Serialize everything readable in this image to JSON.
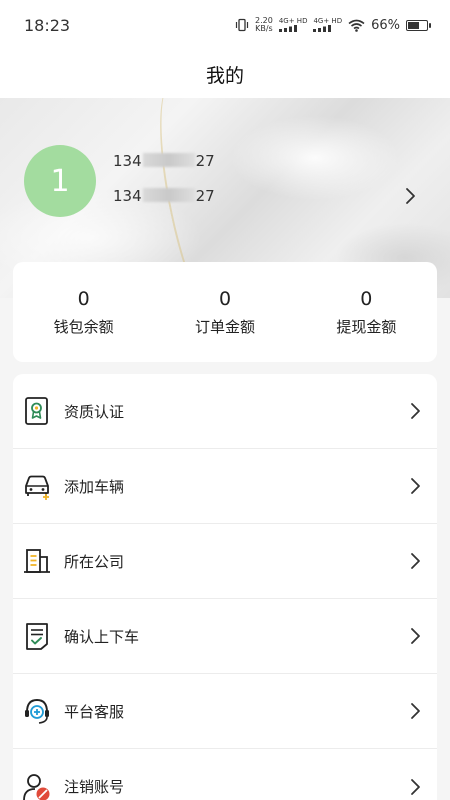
{
  "status_bar": {
    "time": "18:23",
    "net_speed": "2.20",
    "net_speed_unit": "KB/s",
    "network_1": "4G+ HD",
    "network_2": "4G+ HD",
    "battery_percent": "66%",
    "battery_level": 0.66,
    "icons": [
      "vibrate-icon",
      "signal-icon",
      "signal-icon",
      "wifi-icon",
      "battery-icon"
    ]
  },
  "header": {
    "title": "我的"
  },
  "profile": {
    "avatar_text": "1",
    "avatar_color": "#a3dc9f",
    "phone_prefix_1": "134",
    "phone_suffix_1": "27",
    "phone_prefix_2": "134",
    "phone_suffix_2": "27"
  },
  "stats": [
    {
      "value": "0",
      "label": "钱包余额"
    },
    {
      "value": "0",
      "label": "订单金额"
    },
    {
      "value": "0",
      "label": "提现金额"
    }
  ],
  "menu": [
    {
      "label": "资质认证",
      "icon": "certificate-icon"
    },
    {
      "label": "添加车辆",
      "icon": "add-vehicle-icon"
    },
    {
      "label": "所在公司",
      "icon": "company-building-icon"
    },
    {
      "label": "确认上下车",
      "icon": "confirm-document-icon"
    },
    {
      "label": "平台客服",
      "icon": "customer-service-icon"
    },
    {
      "label": "注销账号",
      "icon": "cancel-account-icon"
    }
  ],
  "colors": {
    "accent_yellow": "#f0b429",
    "accent_green": "#2e8b57",
    "accent_teal": "#1f9bd6",
    "accent_red": "#e04a3a"
  }
}
